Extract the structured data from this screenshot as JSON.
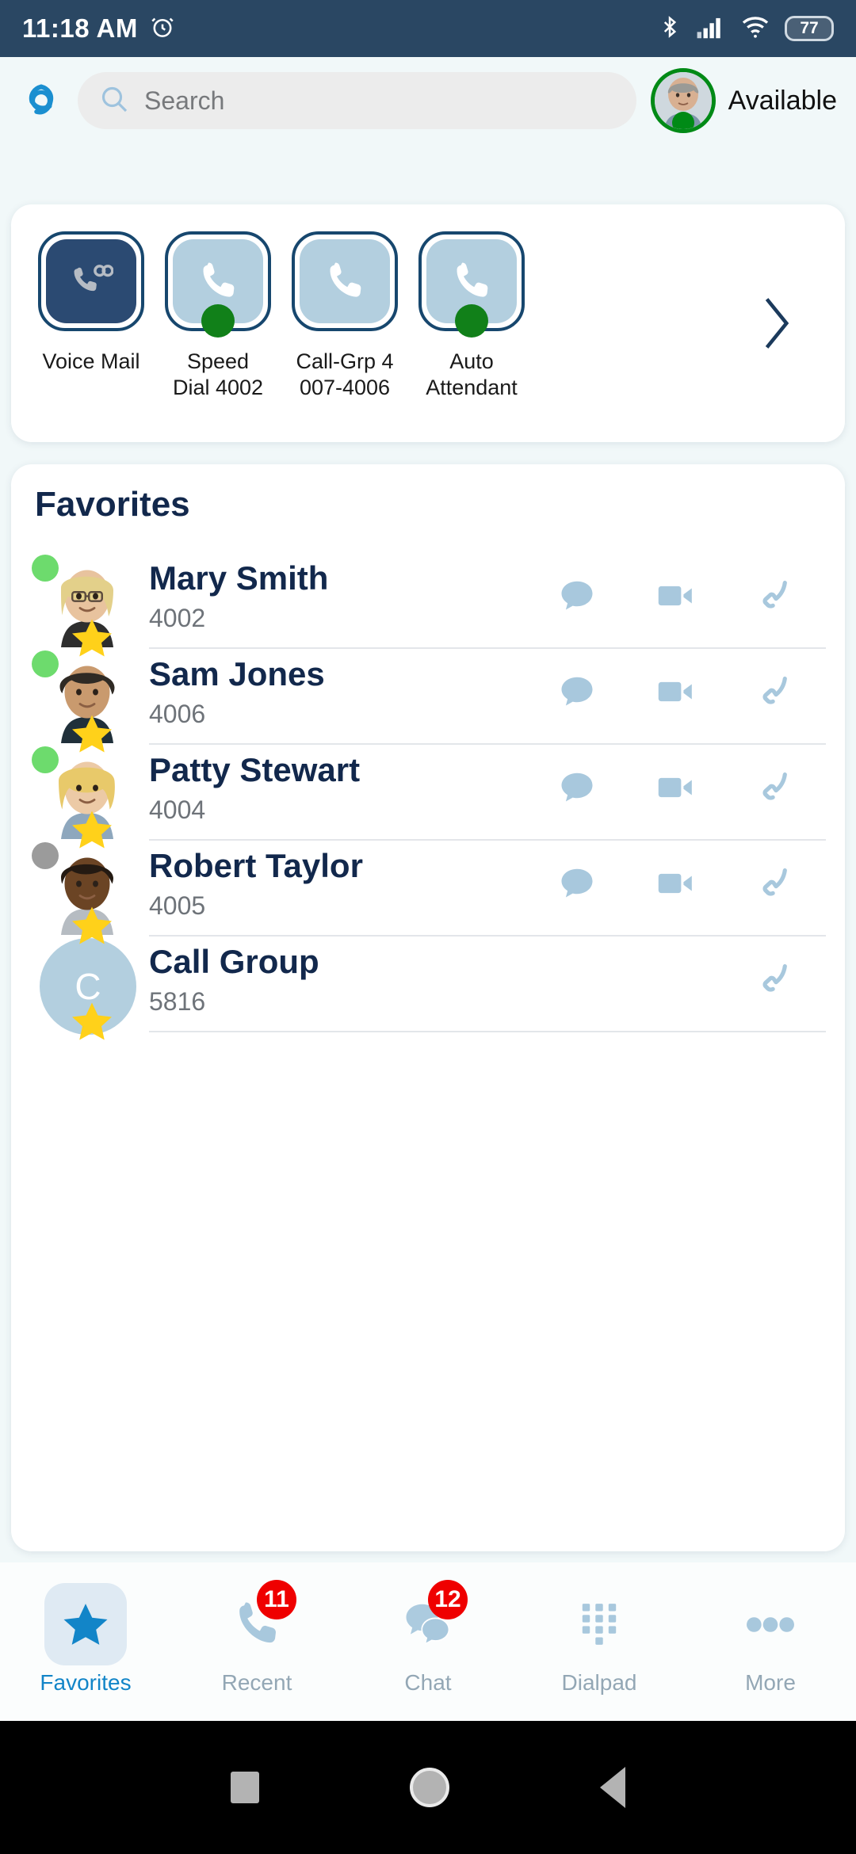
{
  "status_bar": {
    "time": "11:18 AM",
    "alarm_icon": "alarm-icon",
    "bluetooth_icon": "bluetooth-icon",
    "signal_icon": "cellular-signal-icon",
    "wifi_icon": "wifi-icon",
    "battery_level": "77"
  },
  "header": {
    "logo_icon": "app-logo-icon",
    "search": {
      "placeholder": "Search",
      "value": "",
      "icon": "search-icon"
    },
    "presence_label": "Available",
    "presence_color": "#008a16",
    "avatar_icon": "user-avatar"
  },
  "quick_actions": {
    "next_icon": "chevron-right-icon",
    "tiles": [
      {
        "label_line1": "Voice Mail",
        "label_line2": "",
        "icon": "voicemail-icon",
        "style": "dark",
        "dot": false
      },
      {
        "label_line1": "Speed",
        "label_line2": "Dial 4002",
        "icon": "phone-icon",
        "style": "light",
        "dot": true
      },
      {
        "label_line1": "Call-Grp 4",
        "label_line2": "007-4006",
        "icon": "phone-icon",
        "style": "light",
        "dot": false
      },
      {
        "label_line1": "Auto",
        "label_line2": "Attendant",
        "icon": "phone-icon",
        "style": "light",
        "dot": true
      }
    ]
  },
  "favorites": {
    "title": "Favorites",
    "contacts": [
      {
        "name": "Mary Smith",
        "ext": "4002",
        "presence": "online",
        "avatar_kind": "photo",
        "initial": "",
        "star": true,
        "actions": [
          "chat-icon",
          "video-icon",
          "call-icon"
        ]
      },
      {
        "name": "Sam Jones",
        "ext": "4006",
        "presence": "online",
        "avatar_kind": "photo",
        "initial": "",
        "star": true,
        "actions": [
          "chat-icon",
          "video-icon",
          "call-icon"
        ]
      },
      {
        "name": "Patty Stewart",
        "ext": "4004",
        "presence": "online",
        "avatar_kind": "photo",
        "initial": "",
        "star": true,
        "actions": [
          "chat-icon",
          "video-icon",
          "call-icon"
        ]
      },
      {
        "name": "Robert Taylor",
        "ext": "4005",
        "presence": "offline",
        "avatar_kind": "photo",
        "initial": "",
        "star": true,
        "actions": [
          "chat-icon",
          "video-icon",
          "call-icon"
        ]
      },
      {
        "name": "Call Group",
        "ext": "5816",
        "presence": "none",
        "avatar_kind": "initial",
        "initial": "C",
        "star": true,
        "actions": [
          "call-icon"
        ]
      }
    ]
  },
  "tabbar": {
    "tabs": [
      {
        "label": "Favorites",
        "icon": "star-icon",
        "active": true,
        "badge": ""
      },
      {
        "label": "Recent",
        "icon": "phone-icon",
        "active": false,
        "badge": "11"
      },
      {
        "label": "Chat",
        "icon": "chat-icon",
        "active": false,
        "badge": "12"
      },
      {
        "label": "Dialpad",
        "icon": "dialpad-icon",
        "active": false,
        "badge": ""
      },
      {
        "label": "More",
        "icon": "more-icon",
        "active": false,
        "badge": ""
      }
    ]
  },
  "navbar": {
    "recents_icon": "square-recents-icon",
    "home_icon": "circle-home-icon",
    "back_icon": "triangle-back-icon"
  },
  "colors": {
    "page_bg": "#f1f8f9",
    "status_bar_bg": "#2a4763",
    "navy": "#12284c",
    "accent_blue": "#1285c8",
    "tile_light": "#b3cfdf",
    "tile_dark": "#2b4a72",
    "badge_red": "#ef0000",
    "presence_online": "#6ddb6d",
    "presence_offline": "#9b9b9b",
    "star_yellow": "#ffd11a"
  }
}
